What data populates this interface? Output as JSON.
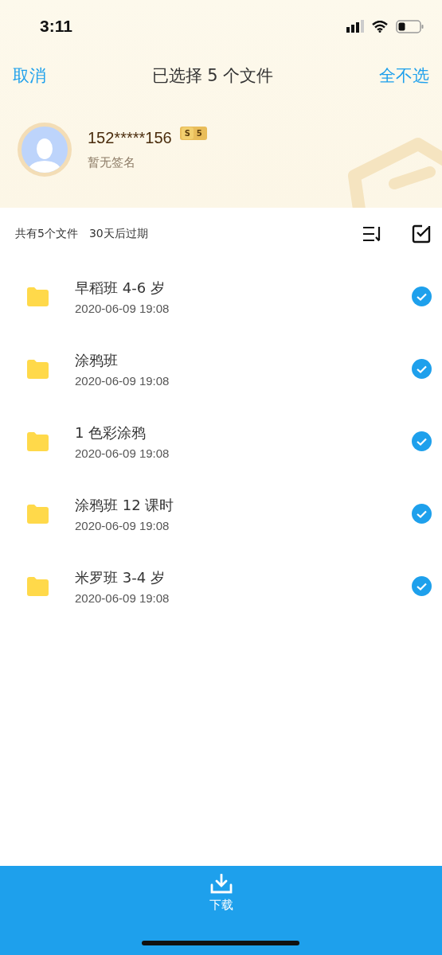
{
  "status_bar": {
    "time": "3:11"
  },
  "nav": {
    "cancel": "取消",
    "title": "已选择 5 个文件",
    "deselect_all": "全不选"
  },
  "profile": {
    "name": "152*****156",
    "badge": {
      "letter": "S",
      "level_text": "5"
    },
    "signature": "暂无签名"
  },
  "summary": {
    "count": "共有5个文件",
    "expiry": "30天后过期"
  },
  "files": [
    {
      "name": "早稻班 4-6 岁",
      "date": "2020-06-09 19:08",
      "selected": true
    },
    {
      "name": "涂鸦班",
      "date": "2020-06-09 19:08",
      "selected": true
    },
    {
      "name": "1 色彩涂鸦",
      "date": "2020-06-09 19:08",
      "selected": true
    },
    {
      "name": "涂鸦班 12 课时",
      "date": "2020-06-09 19:08",
      "selected": true
    },
    {
      "name": "米罗班 3-4 岁",
      "date": "2020-06-09 19:08",
      "selected": true
    }
  ],
  "bottom_bar": {
    "download": "下载"
  }
}
